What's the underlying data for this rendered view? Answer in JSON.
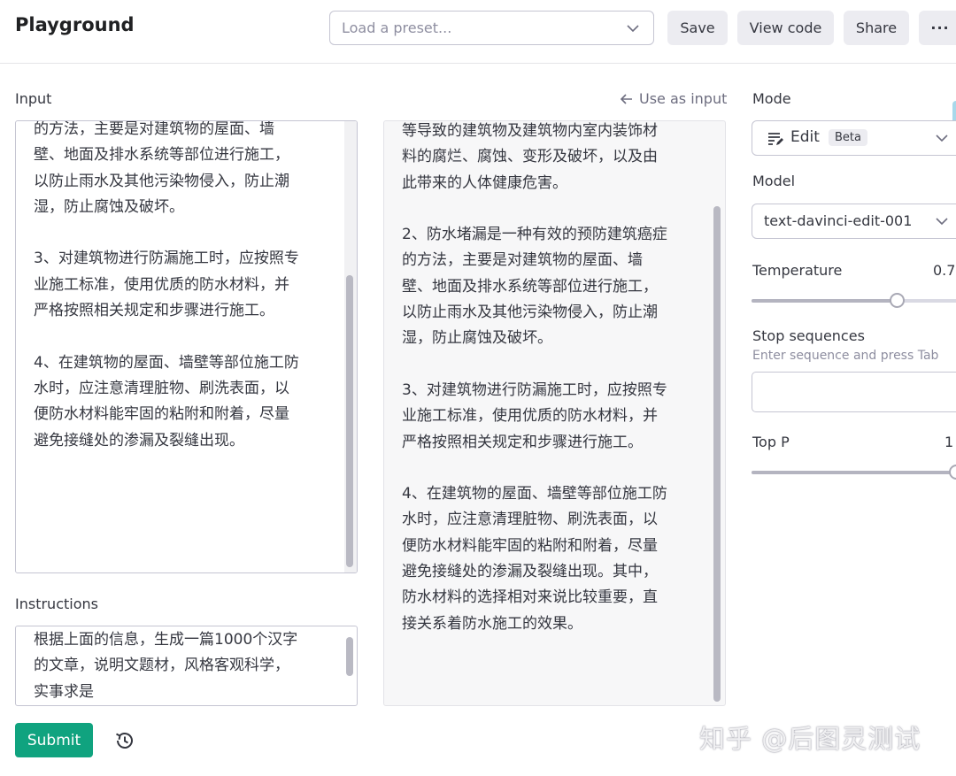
{
  "header": {
    "title": "Playground",
    "preset_placeholder": "Load a preset...",
    "save_label": "Save",
    "view_code_label": "View code",
    "share_label": "Share",
    "more_label": "···"
  },
  "input": {
    "label": "Input",
    "text": "的方法，主要是对建筑物的屋面、墙\n壁、地面及排水系统等部位进行施工，\n以防止雨水及其他污染物侵入，防止潮\n湿，防止腐蚀及破坏。\n\n3、对建筑物进行防漏施工时，应按照专\n业施工标准，使用优质的防水材料，并\n严格按照相关规定和步骤进行施工。\n\n4、在建筑物的屋面、墙壁等部位施工防\n水时，应注意清理脏物、刷洗表面，以\n便防水材料能牢固的粘附和附着，尽量\n避免接缝处的渗漏及裂缝出现。"
  },
  "instructions": {
    "label": "Instructions",
    "text": "根据上面的信息，生成一篇1000个汉字\n的文章，说明文题材，风格客观科学，\n实事求是"
  },
  "output": {
    "use_as_input_label": "Use as input",
    "text": "等导致的建筑物及建筑物内室内装饰材\n料的腐烂、腐蚀、变形及破坏，以及由\n此带来的人体健康危害。\n\n2、防水堵漏是一种有效的预防建筑癌症\n的方法，主要是对建筑物的屋面、墙\n壁、地面及排水系统等部位进行施工，\n以防止雨水及其他污染物侵入，防止潮\n湿，防止腐蚀及破坏。\n\n3、对建筑物进行防漏施工时，应按照专\n业施工标准，使用优质的防水材料，并\n严格按照相关规定和步骤进行施工。\n\n4、在建筑物的屋面、墙壁等部位施工防\n水时，应注意清理脏物、刷洗表面，以\n便防水材料能牢固的粘附和附着，尽量\n避免接缝处的渗漏及裂缝出现。其中，\n防水材料的选择相对来说比较重要，直\n接关系着防水施工的效果。"
  },
  "settings": {
    "mode_label": "Mode",
    "mode_value": "Edit",
    "mode_badge": "Beta",
    "model_label": "Model",
    "model_value": "text-davinci-edit-001",
    "temperature_label": "Temperature",
    "temperature_value": "0.7",
    "temperature_fraction": 0.7,
    "stop_label": "Stop sequences",
    "stop_hint": "Enter sequence and press Tab",
    "top_p_label": "Top P",
    "top_p_value": "1",
    "top_p_fraction": 1
  },
  "footer": {
    "submit_label": "Submit",
    "watermark": "知乎 @后图灵测试"
  },
  "colors": {
    "accent": "#10a37f",
    "button_bg": "#ececf1"
  }
}
